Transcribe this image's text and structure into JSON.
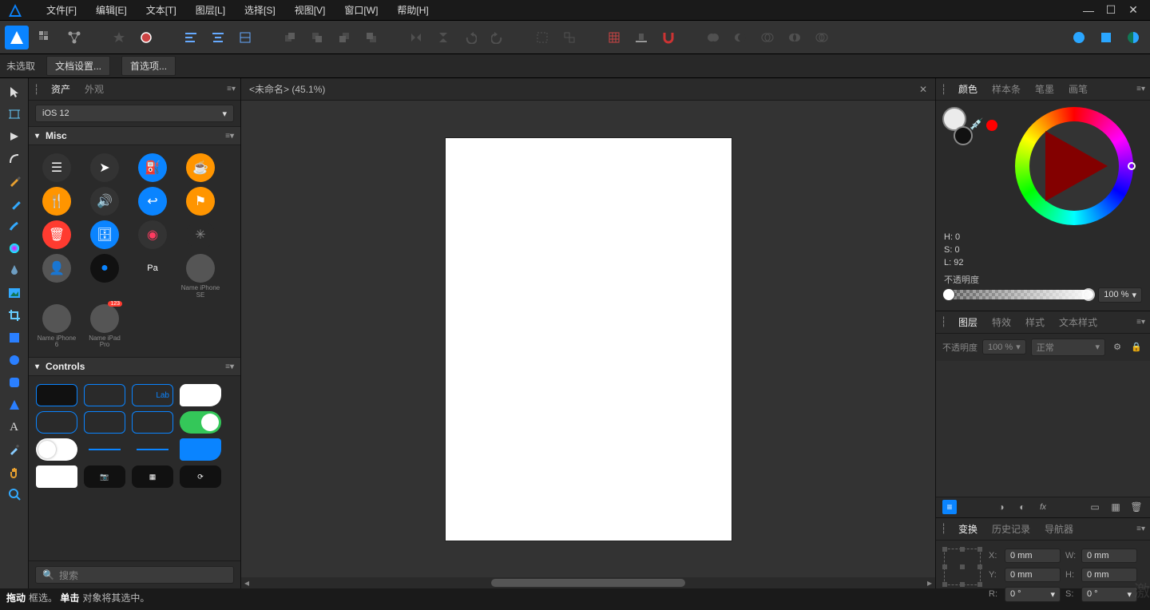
{
  "menu": {
    "file": "文件[F]",
    "edit": "编辑[E]",
    "text": "文本[T]",
    "layer": "图层[L]",
    "select": "选择[S]",
    "view": "视图[V]",
    "window": "窗口[W]",
    "help": "帮助[H]"
  },
  "contextbar": {
    "no_selection": "未选取",
    "doc_setup": "文档设置...",
    "preferences": "首选项..."
  },
  "left_panel": {
    "tabs": {
      "assets": "资产",
      "appearance": "外观"
    },
    "preset": "iOS 12",
    "categories": {
      "misc": "Misc",
      "controls": "Controls"
    },
    "misc_labels": {
      "iphone_se": "Name\niPhone SE",
      "iphone_6": "Name\niPhone 6",
      "ipad_pro": "Name\niPad Pro"
    },
    "controls_text": {
      "lab": "Lab"
    },
    "search_placeholder": "搜索"
  },
  "document": {
    "tab_title": "<未命名> (45.1%)"
  },
  "right": {
    "colour_tabs": {
      "colour": "颜色",
      "swatches": "样本条",
      "brushes": "笔墨",
      "strokes": "画笔"
    },
    "hsl": {
      "h": "H: 0",
      "s": "S: 0",
      "l": "L: 92"
    },
    "opacity_label": "不透明度",
    "opacity_value": "100 %",
    "layer_tabs": {
      "layers": "图层",
      "effects": "特效",
      "styles": "样式",
      "text_styles": "文本样式"
    },
    "layer_opts": {
      "opacity_label": "不透明度",
      "opacity_value": "100 %",
      "blend": "正常"
    },
    "transform_tabs": {
      "transform": "变换",
      "history": "历史记录",
      "navigator": "导航器"
    },
    "xf": {
      "x_label": "X:",
      "x_val": "0 mm",
      "y_label": "Y:",
      "y_val": "0 mm",
      "w_label": "W:",
      "w_val": "0 mm",
      "h_label": "H:",
      "h_val": "0 mm",
      "r_label": "R:",
      "r_val": "0 °",
      "s_label": "S:",
      "s_val": "0 °"
    }
  },
  "status": {
    "drag_b": "拖动",
    "drag_t": "框选。",
    "click_b": "单击",
    "click_t": "对象将其选中。"
  },
  "watermark": "激"
}
